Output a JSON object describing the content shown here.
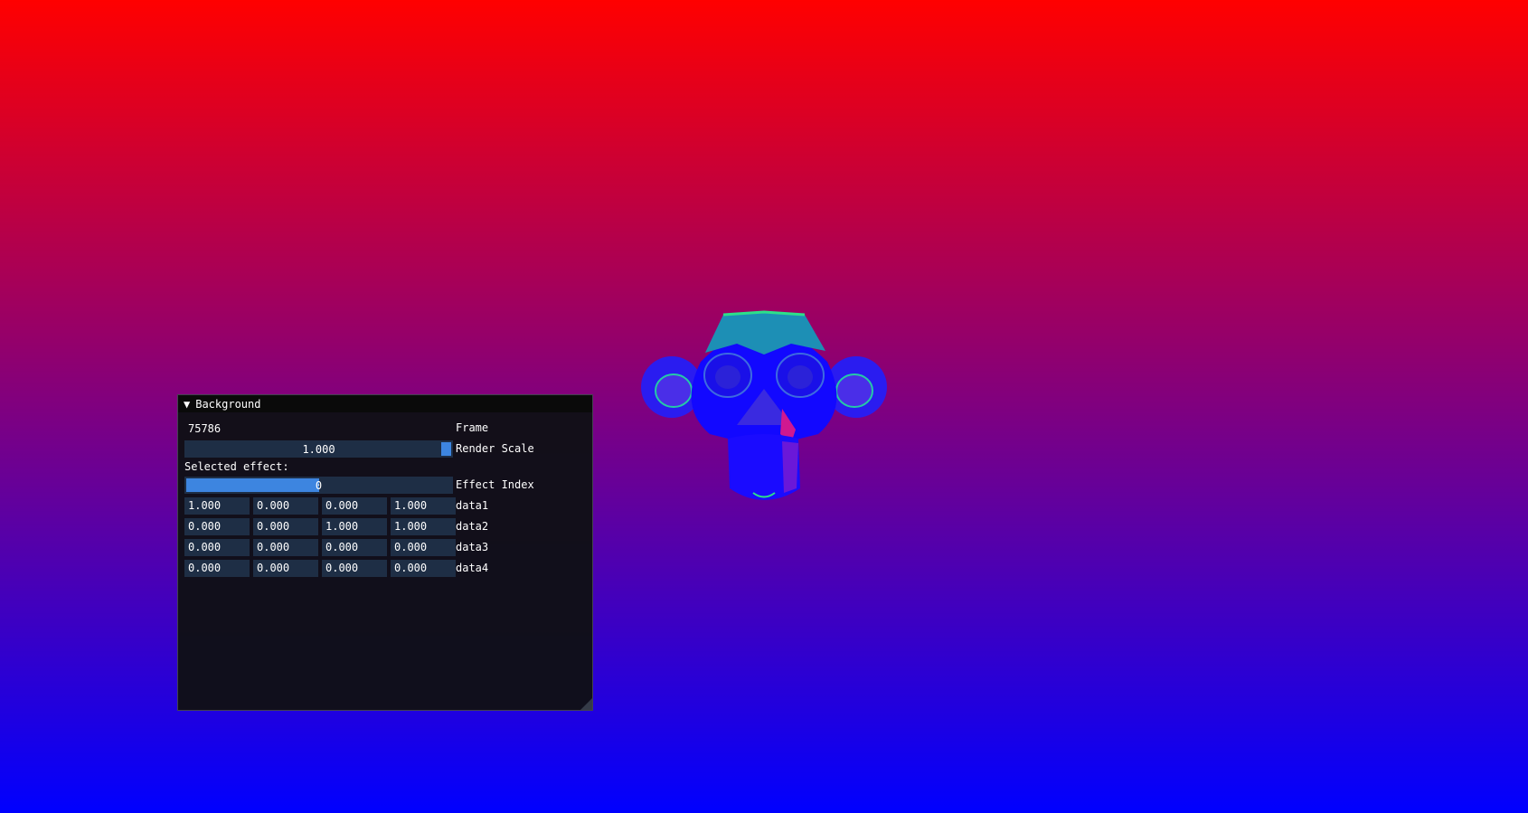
{
  "panel": {
    "title": "Background",
    "frame": {
      "value": "75786",
      "label": "Frame"
    },
    "render_scale": {
      "value": "1.000",
      "label": "Render Scale"
    },
    "selected_effect_text": "Selected effect:",
    "effect_index": {
      "value": "0",
      "label": "Effect Index",
      "fraction": 0.5
    },
    "vectors": [
      {
        "label": "data1",
        "values": [
          "1.000",
          "0.000",
          "0.000",
          "1.000"
        ]
      },
      {
        "label": "data2",
        "values": [
          "0.000",
          "0.000",
          "1.000",
          "1.000"
        ]
      },
      {
        "label": "data3",
        "values": [
          "0.000",
          "0.000",
          "0.000",
          "0.000"
        ]
      },
      {
        "label": "data4",
        "values": [
          "0.000",
          "0.000",
          "0.000",
          "0.000"
        ]
      }
    ]
  },
  "colors": {
    "background_top": "#ff0000",
    "background_bottom": "#0000ff",
    "widget_bg": "#1e2e45",
    "accent": "#3d85e0"
  },
  "icons": {
    "collapse": "triangle-down-icon",
    "model": "monkey-head-model"
  }
}
